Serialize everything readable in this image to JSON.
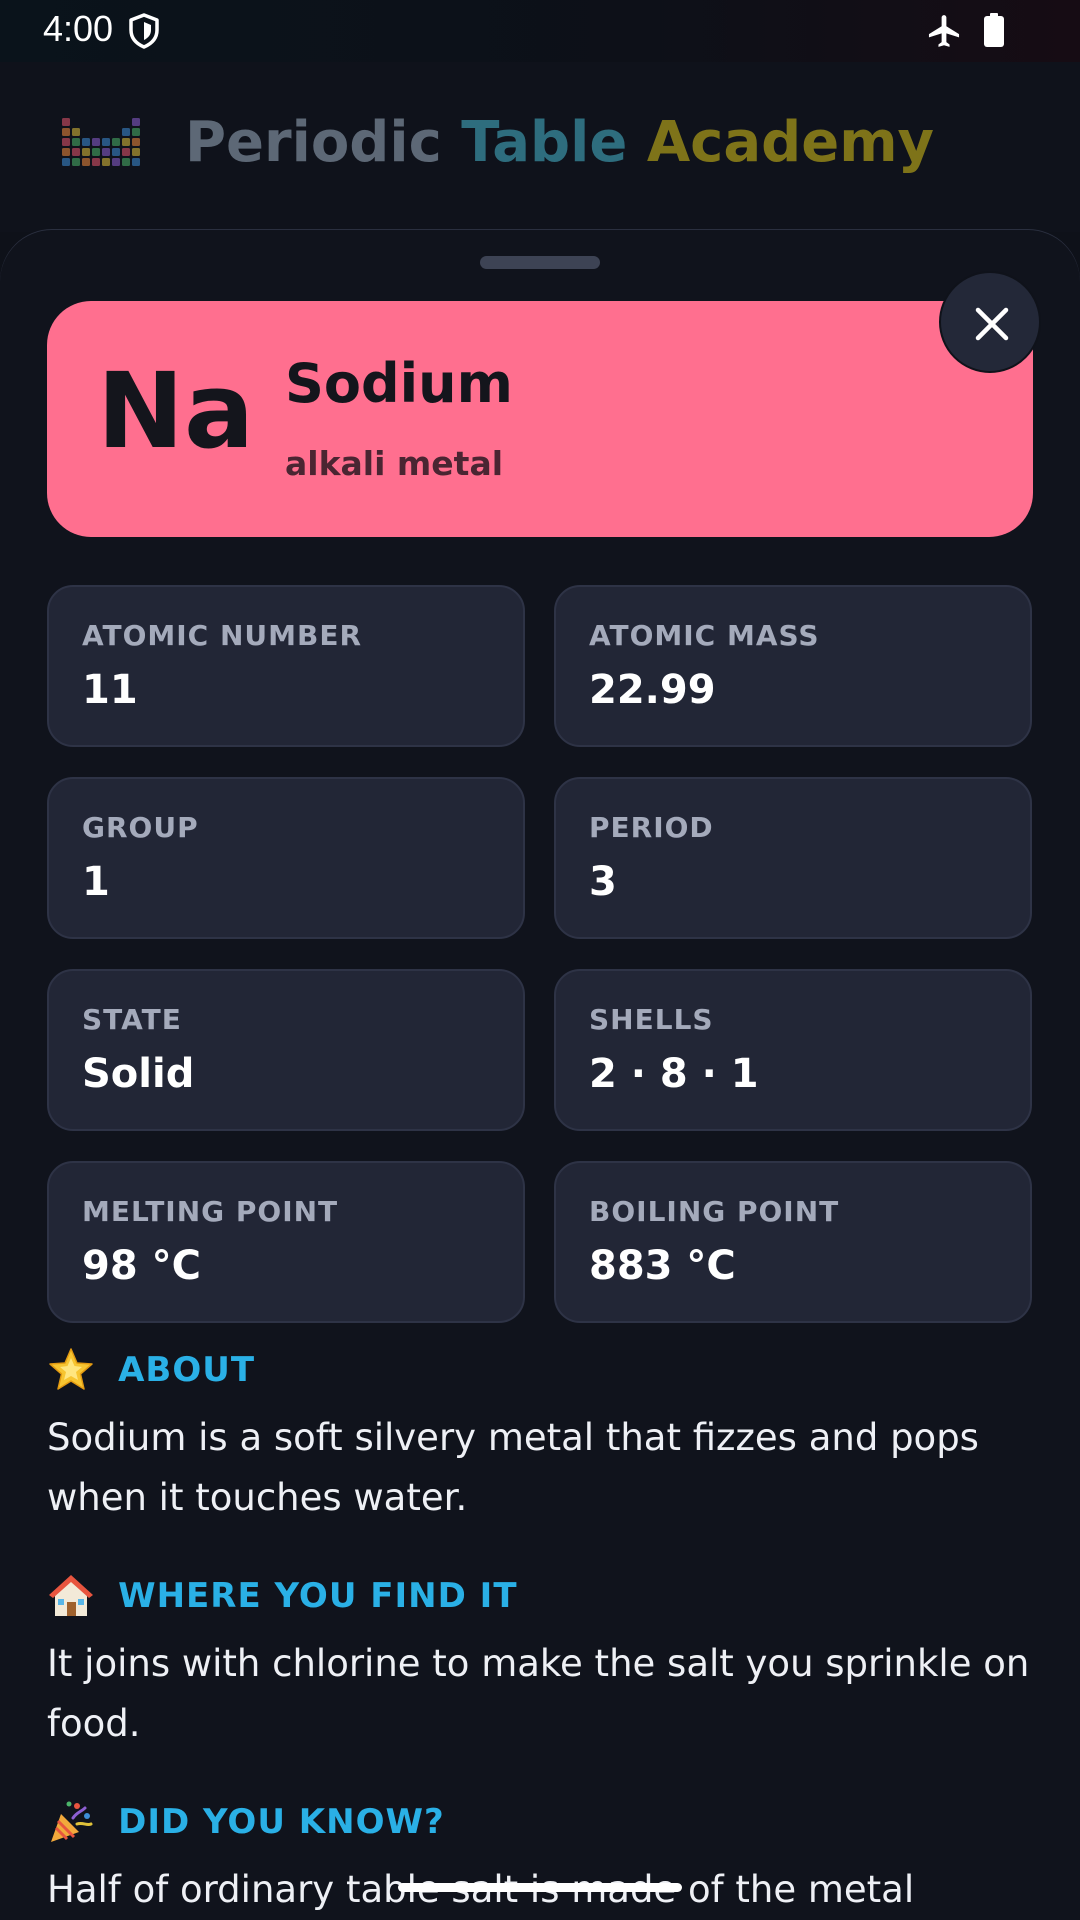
{
  "status_bar": {
    "time": "4:00"
  },
  "app": {
    "title_part1": "Periodic ",
    "title_part2": "Table ",
    "title_part3": "Academy"
  },
  "element": {
    "symbol": "Na",
    "name": "Sodium",
    "category": "alkali metal",
    "card_color": "#ff6f8f"
  },
  "stats": [
    {
      "label": "ATOMIC NUMBER",
      "value": "11"
    },
    {
      "label": "ATOMIC MASS",
      "value": "22.99"
    },
    {
      "label": "GROUP",
      "value": "1"
    },
    {
      "label": "PERIOD",
      "value": "3"
    },
    {
      "label": "STATE",
      "value": "Solid"
    },
    {
      "label": "SHELLS",
      "value": "2 · 8 · 1"
    },
    {
      "label": "MELTING POINT",
      "value": "98 °C"
    },
    {
      "label": "BOILING POINT",
      "value": "883 °C"
    }
  ],
  "sections": [
    {
      "icon": "star-icon",
      "title": "ABOUT",
      "body": "Sodium is a soft silvery metal that fizzes and pops when it touches water."
    },
    {
      "icon": "house-icon",
      "title": "WHERE YOU FIND IT",
      "body": "It joins with chlorine to make the salt you sprinkle on food."
    },
    {
      "icon": "party-popper-icon",
      "title": "DID YOU KNOW?",
      "body": "Half of ordinary table salt is made of the metal"
    }
  ],
  "colors": {
    "accent": "#2ab0e6",
    "background": "#0e1119",
    "stat_card": "#222636"
  }
}
